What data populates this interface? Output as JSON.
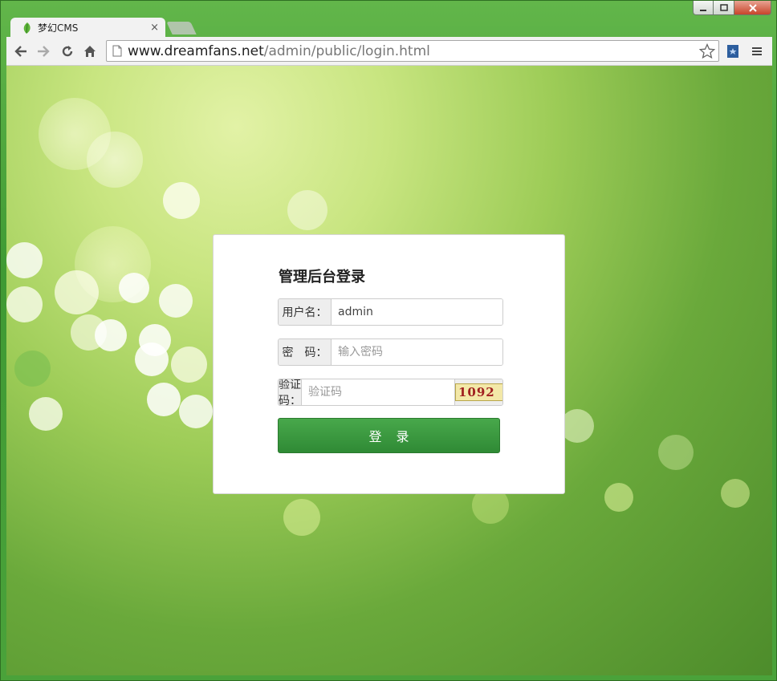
{
  "browser": {
    "tab_title": "梦幻CMS",
    "tab_close": "×",
    "url_domain": "www.dreamfans.net",
    "url_path": "/admin/public/login.html",
    "icons": [
      "back-icon",
      "forward-icon",
      "reload-icon",
      "home-icon",
      "page-icon",
      "star-icon",
      "extension-icon",
      "menu-icon"
    ]
  },
  "login": {
    "title": "管理后台登录",
    "username_label": "用户名：",
    "username_value": "admin",
    "password_label": "密　码：",
    "password_placeholder": "输入密码",
    "captcha_label": "验证码：",
    "captcha_placeholder": "验证码",
    "captcha_text": "1092",
    "submit_label": "登录"
  },
  "colors": {
    "accent": "#3a9a3e",
    "background": "#8cc24a"
  }
}
